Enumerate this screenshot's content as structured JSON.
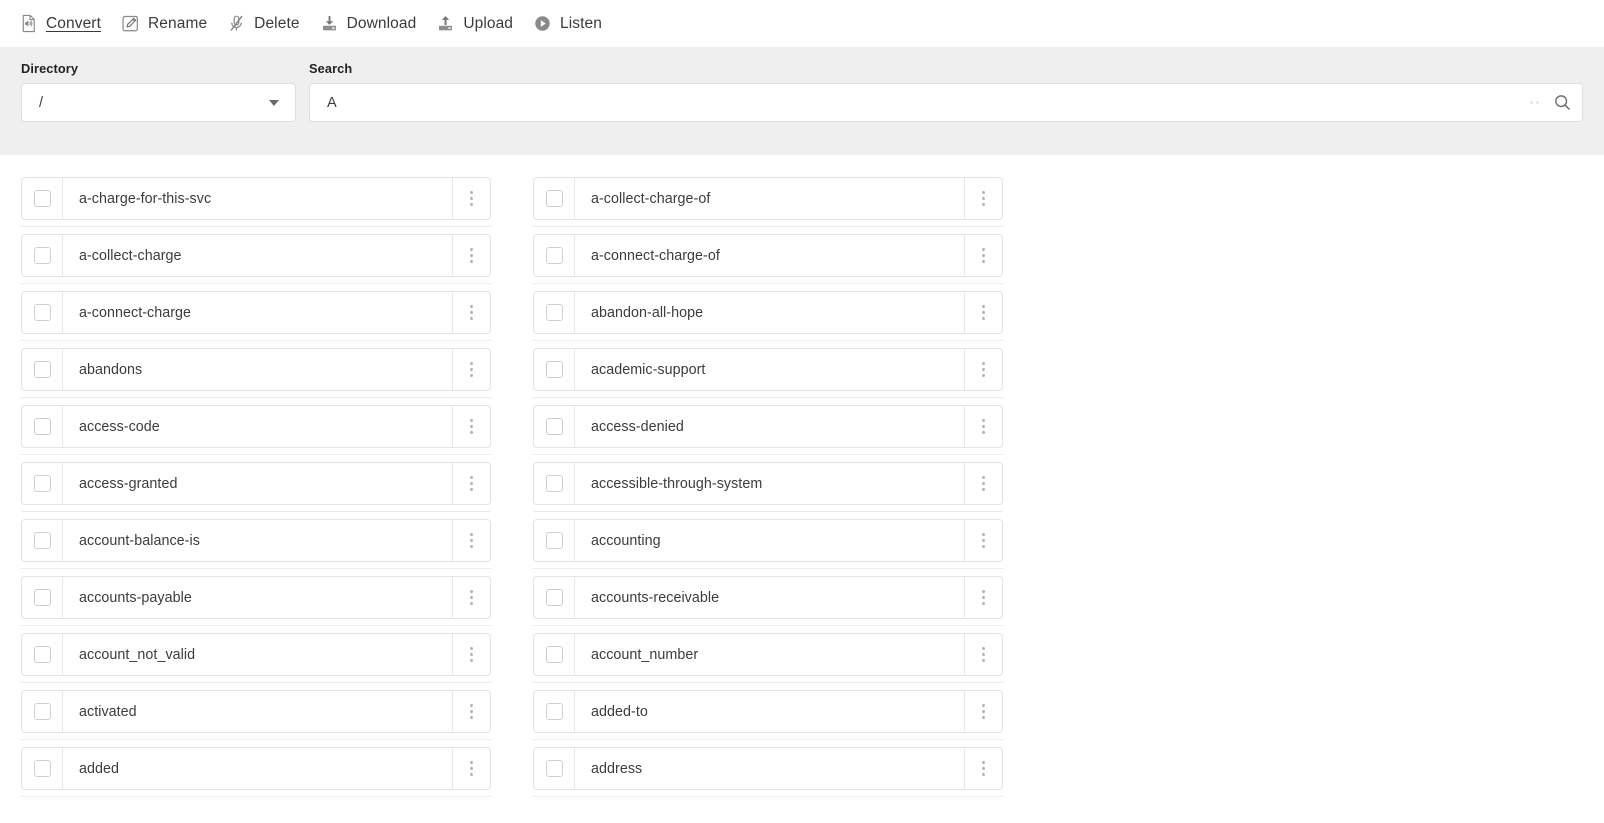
{
  "toolbar": {
    "items": [
      {
        "label": "Convert",
        "icon": "convert-audio-document-icon",
        "active": true
      },
      {
        "label": "Rename",
        "icon": "pencil-square-icon",
        "active": false
      },
      {
        "label": "Delete",
        "icon": "microphone-slash-icon",
        "active": false
      },
      {
        "label": "Download",
        "icon": "download-tray-icon",
        "active": false
      },
      {
        "label": "Upload",
        "icon": "upload-tray-icon",
        "active": false
      },
      {
        "label": "Listen",
        "icon": "play-circle-icon",
        "active": false
      }
    ]
  },
  "filters": {
    "directory_label": "Directory",
    "directory_value": "/",
    "directory_options": [
      "/"
    ],
    "search_label": "Search",
    "search_value": "A",
    "search_placeholder": "",
    "search_icon": "magnifier-icon"
  },
  "list": {
    "rows": [
      {
        "left": "a-charge-for-this-svc",
        "right": "a-collect-charge-of"
      },
      {
        "left": "a-collect-charge",
        "right": "a-connect-charge-of"
      },
      {
        "left": "a-connect-charge",
        "right": "abandon-all-hope"
      },
      {
        "left": "abandons",
        "right": "academic-support"
      },
      {
        "left": "access-code",
        "right": "access-denied"
      },
      {
        "left": "access-granted",
        "right": "accessible-through-system"
      },
      {
        "left": "account-balance-is",
        "right": "accounting"
      },
      {
        "left": "accounts-payable",
        "right": "accounts-receivable"
      },
      {
        "left": "account_not_valid",
        "right": "account_number"
      },
      {
        "left": "activated",
        "right": "added-to"
      },
      {
        "left": "added",
        "right": "address"
      }
    ]
  },
  "colors": {
    "page_bg": "#ffffff",
    "filter_bg": "#efefef",
    "border": "#e3e3e3",
    "text": "#3c3c3c",
    "icon_grey": "#808080"
  }
}
